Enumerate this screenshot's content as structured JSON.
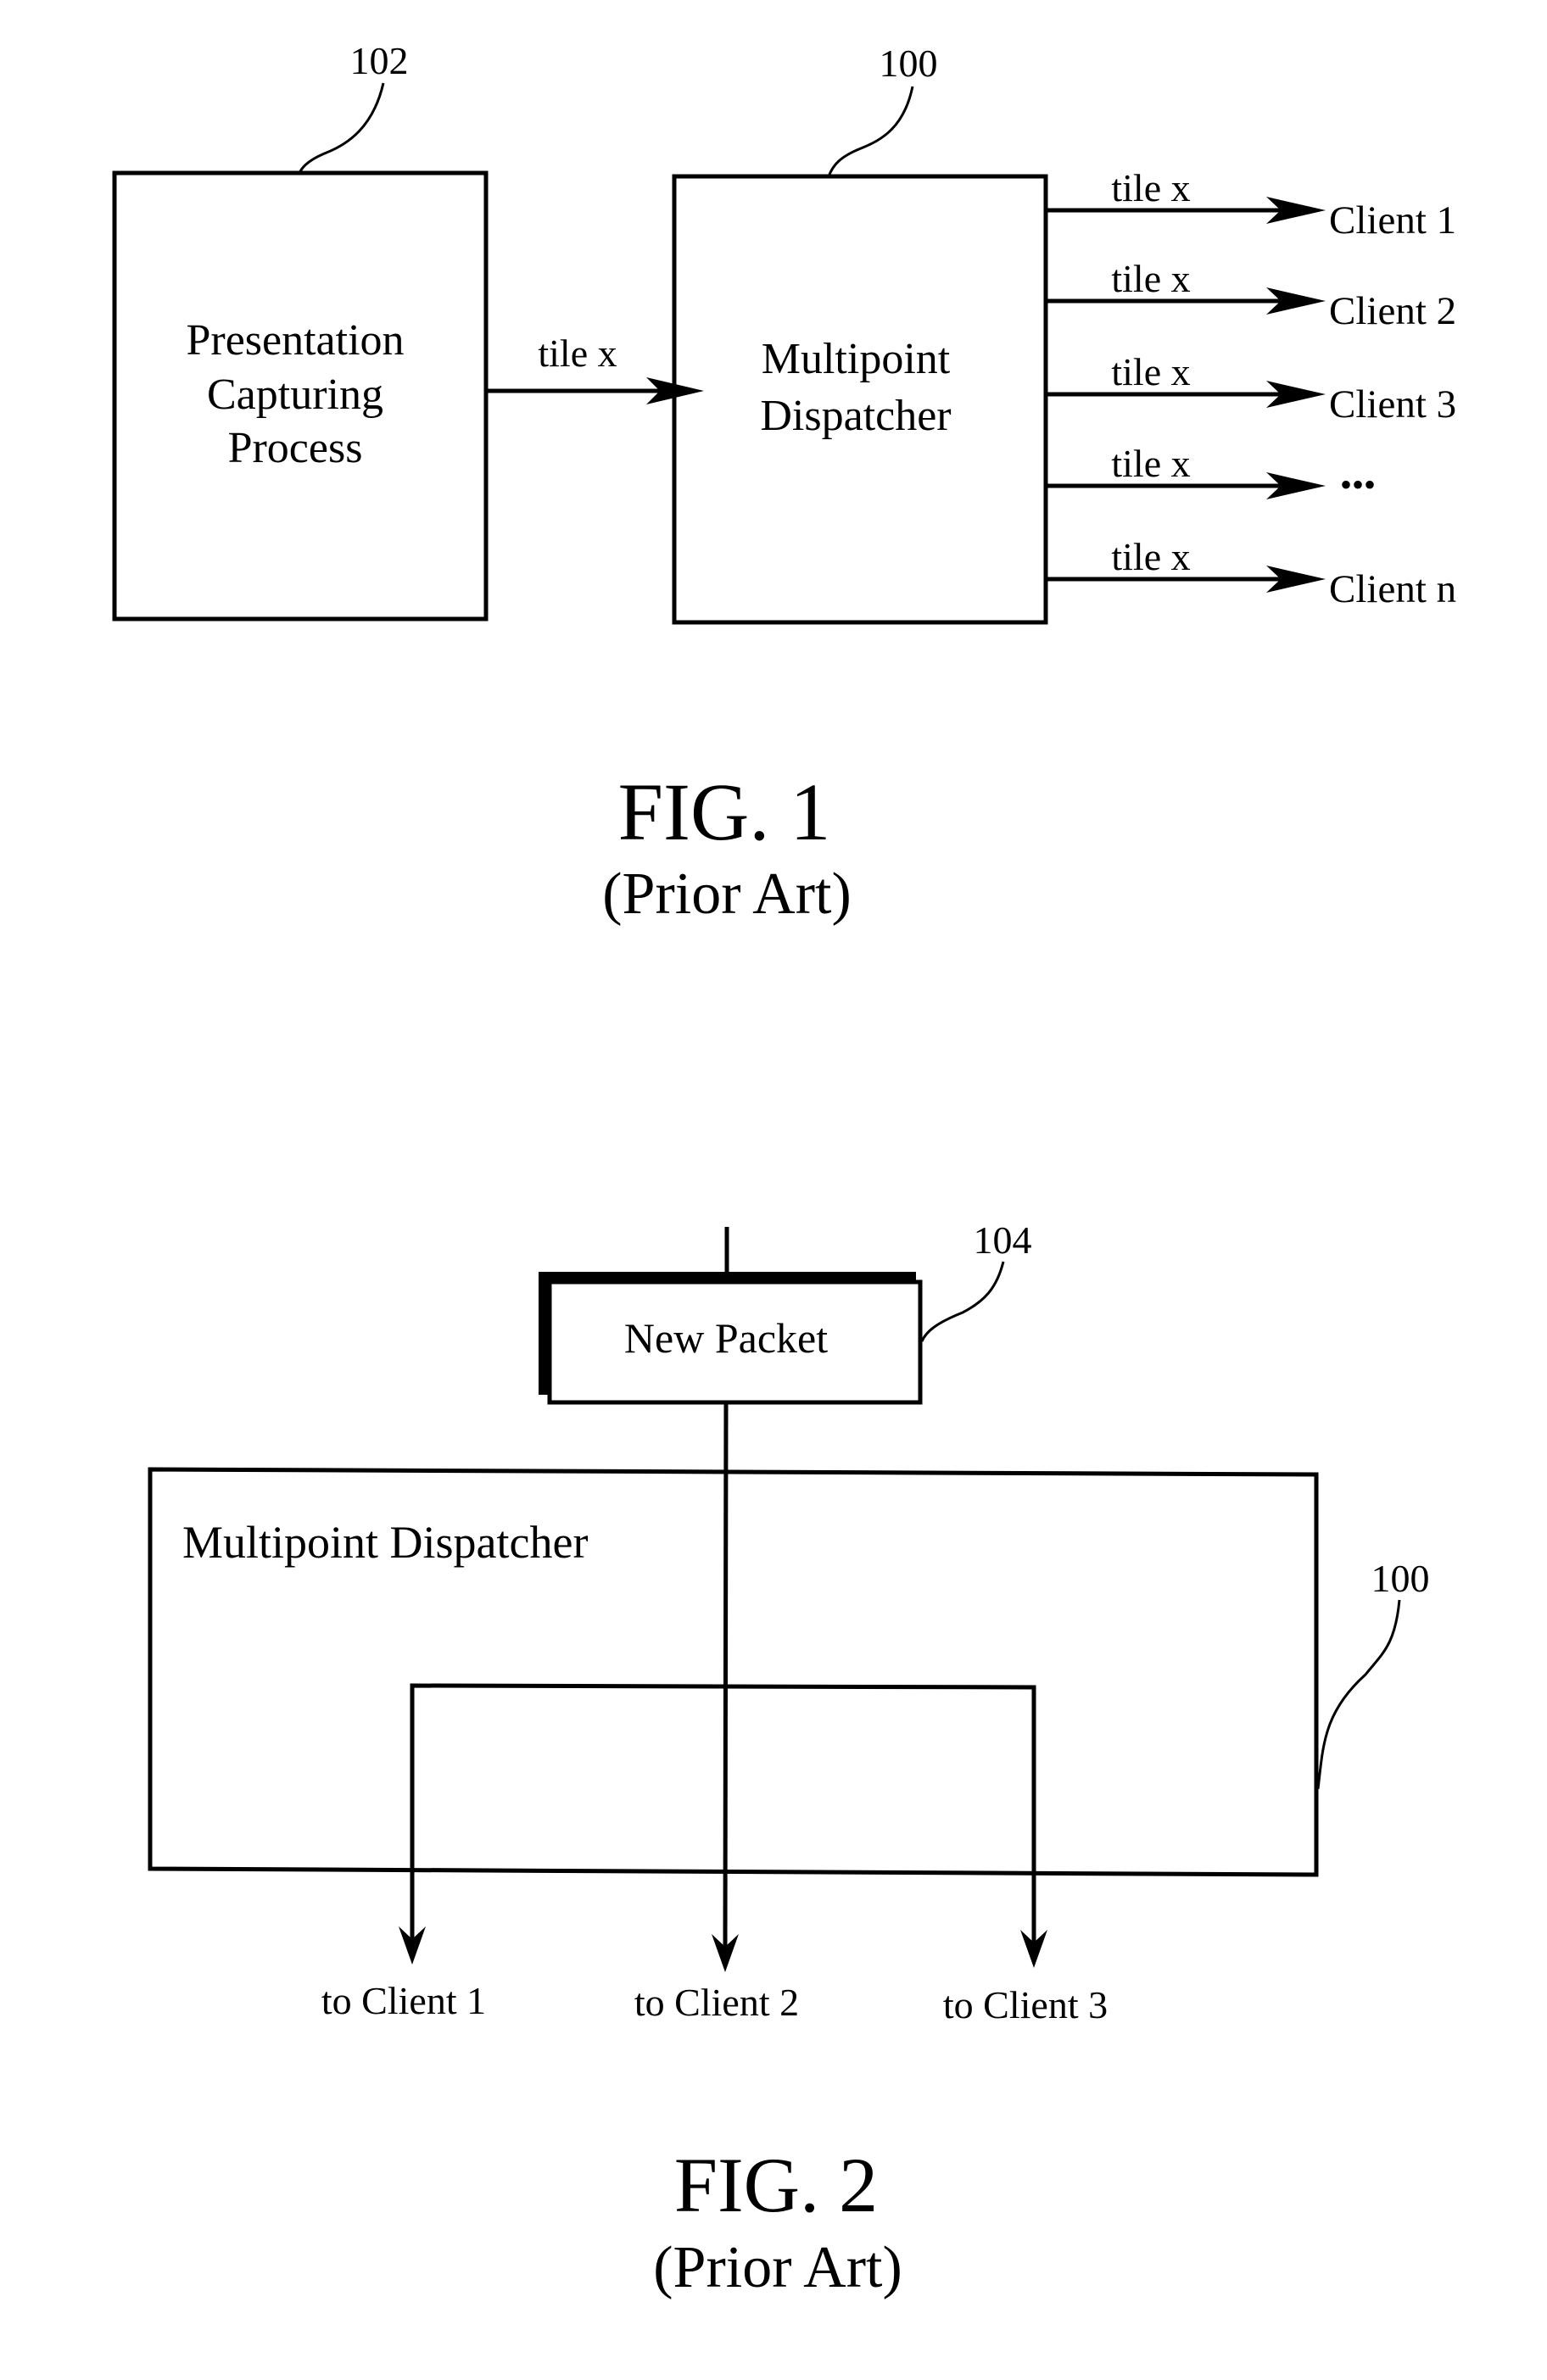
{
  "figure1": {
    "caption": "FIG. 1",
    "subcaption": "(Prior Art)",
    "capture_box": {
      "ref": "102",
      "lines": [
        "Presentation",
        "Capturing",
        "Process"
      ]
    },
    "input_label": "tile x",
    "dispatcher_box": {
      "ref": "100",
      "lines": [
        "Multipoint",
        "Dispatcher"
      ]
    },
    "outputs": [
      {
        "label": "tile x",
        "target": "Client 1"
      },
      {
        "label": "tile x",
        "target": "Client 2"
      },
      {
        "label": "tile x",
        "target": "Client 3"
      },
      {
        "label": "tile x",
        "target": "•••"
      },
      {
        "label": "tile x",
        "target": "Client n"
      }
    ]
  },
  "figure2": {
    "caption": "FIG. 2",
    "subcaption": "(Prior Art)",
    "packet_box": {
      "ref": "104",
      "label": "New Packet"
    },
    "dispatcher_box": {
      "ref": "100",
      "label": "Multipoint Dispatcher"
    },
    "outputs": [
      "to Client 1",
      "to Client 2",
      "to Client 3"
    ]
  }
}
